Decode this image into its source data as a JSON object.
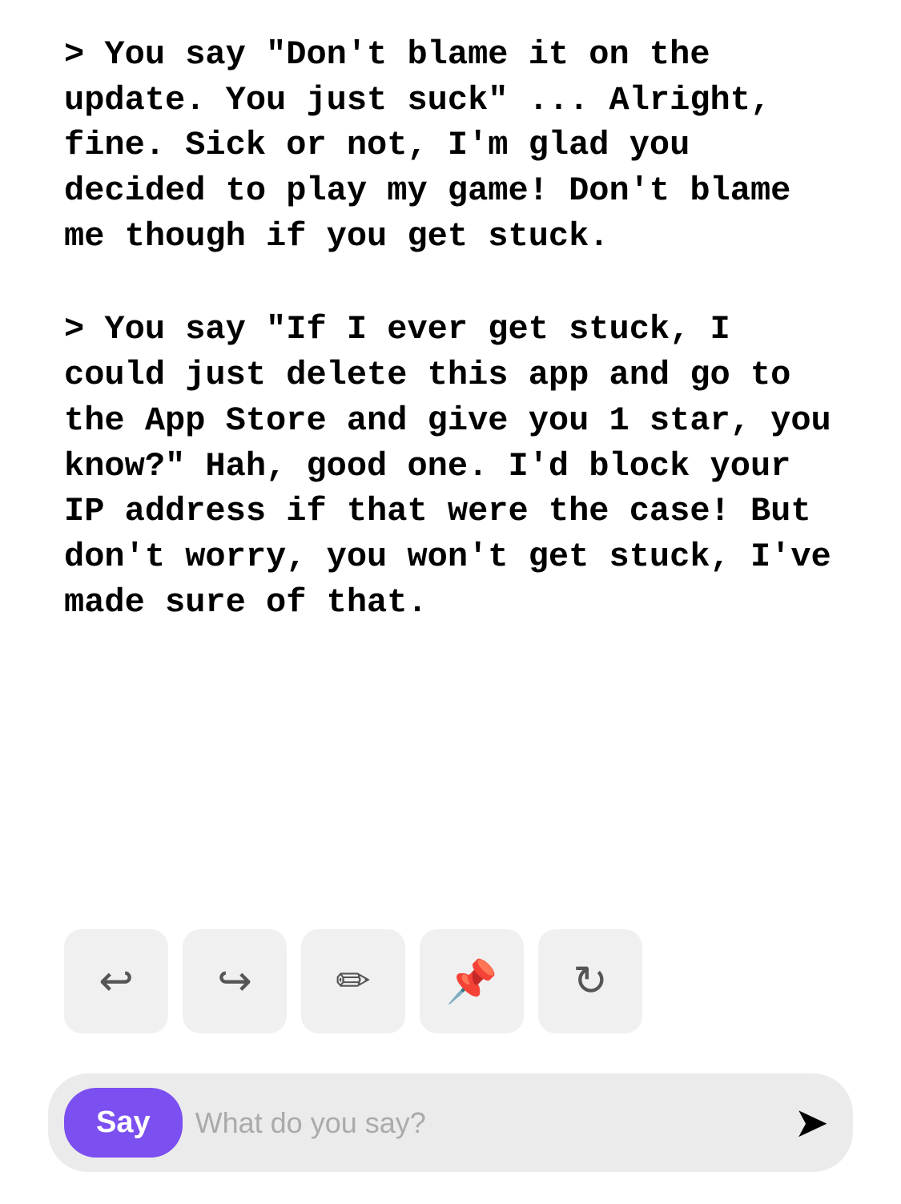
{
  "content": {
    "block1": "> You say \"Don't blame it on the update. You just suck\" ... Alright, fine. Sick or not, I'm glad you decided to play my game! Don't blame me though if you get stuck.",
    "block2": "> You say \"If I ever get stuck, I could just delete this app and go to the App Store and give you 1 star, you know?\" Hah, good one. I'd block your IP address if that were the case! But don't worry, you won't get stuck, I've made sure of that."
  },
  "toolbar": {
    "undo_label": "Undo",
    "redo_label": "Redo",
    "edit_label": "Edit",
    "pin_label": "Pin",
    "refresh_label": "Refresh"
  },
  "input": {
    "say_button_label": "Say",
    "placeholder": "What do you say?",
    "send_icon": "➤"
  }
}
